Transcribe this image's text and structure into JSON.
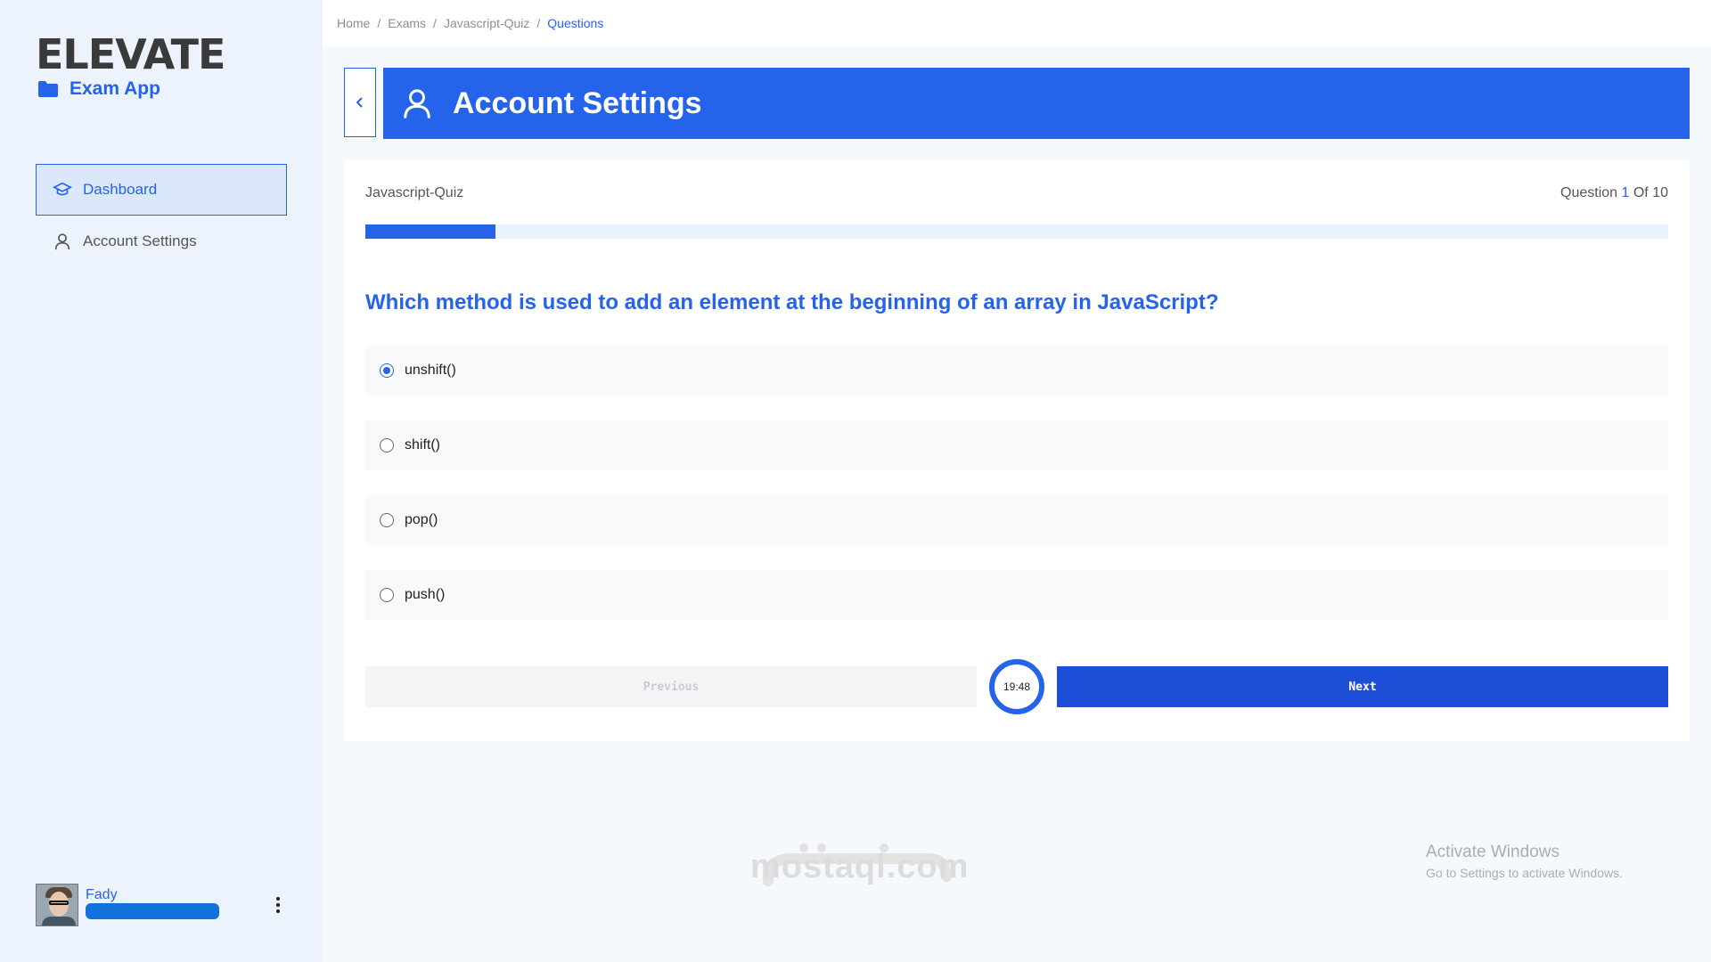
{
  "sidebar": {
    "logo": "ELEVATE",
    "app_name": "Exam App",
    "items": [
      {
        "label": "Dashboard"
      },
      {
        "label": "Account Settings"
      }
    ],
    "user": {
      "name": "Fady"
    }
  },
  "breadcrumb": [
    "Home",
    "Exams",
    "Javascript-Quiz",
    "Questions"
  ],
  "header": {
    "title": "Account Settings"
  },
  "quiz": {
    "name": "Javascript-Quiz",
    "question_label": "Question",
    "current": "1",
    "of_label": "Of",
    "total": "10",
    "progress_fraction": 0.1,
    "question": "Which method is used to add an element at the beginning of an array in JavaScript?",
    "options": [
      "unshift()",
      "shift()",
      "pop()",
      "push()"
    ],
    "selected_index": 0,
    "timer": "19:48",
    "prev_label": "Previous",
    "next_label": "Next"
  },
  "watermark": {
    "text": "mostaql.com"
  },
  "activate": {
    "title": "Activate Windows",
    "subtitle": "Go to Settings to activate Windows."
  }
}
